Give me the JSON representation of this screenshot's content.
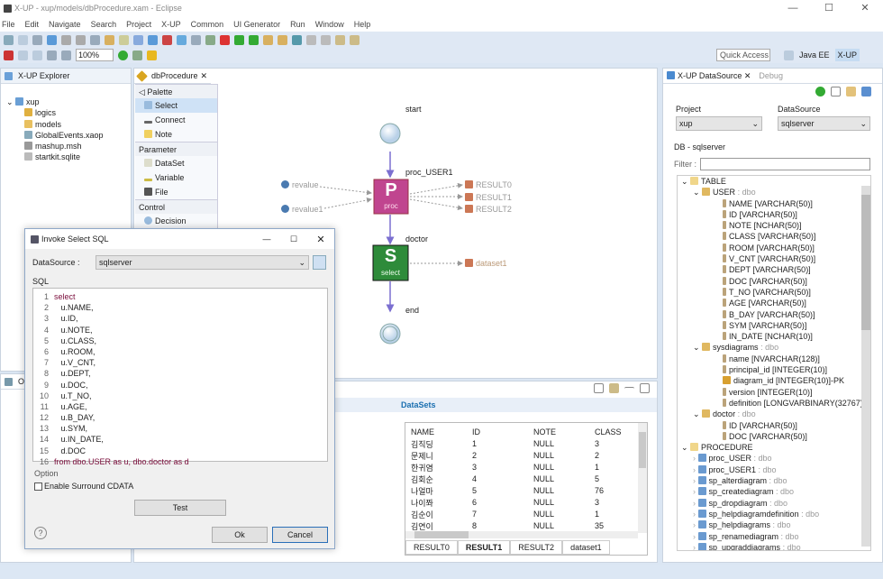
{
  "window": {
    "title": "X-UP - xup/models/dbProcedure.xam - Eclipse",
    "controls": [
      "—",
      "☐",
      "✕"
    ]
  },
  "menu": [
    "File",
    "Edit",
    "Navigate",
    "Search",
    "Project",
    "X-UP",
    "Common",
    "UI Generator",
    "Run",
    "Window",
    "Help"
  ],
  "toolbar": {
    "zoom": "100%",
    "quick_access": "Quick Access",
    "perspectives": [
      "Java EE",
      "X-UP"
    ]
  },
  "explorer": {
    "title": "X-UP Explorer",
    "root": "xup",
    "items": [
      "logics",
      "models",
      "GlobalEvents.xaop",
      "mashup.msh",
      "startkit.sqlite"
    ]
  },
  "outline": {
    "title": "Ou"
  },
  "editor": {
    "tab": "dbProcedure",
    "palette": {
      "title": "Palette",
      "tools": [
        "Select",
        "Connect",
        "Note"
      ],
      "groups": [
        {
          "name": "Parameter",
          "items": [
            "DataSet",
            "Variable",
            "File"
          ]
        },
        {
          "name": "Control",
          "items": [
            "Decision"
          ]
        }
      ]
    },
    "diagram": {
      "start": "start",
      "proc_label": "proc_USER1",
      "proc_icon_letter": "P",
      "proc_sub": "proc",
      "inputs": [
        "revalue",
        "revalue1"
      ],
      "outputs": [
        "RESULT0",
        "RESULT1",
        "RESULT2"
      ],
      "select_label": "doctor",
      "select_icon_letter": "S",
      "select_sub": "select",
      "select_output": "dataset1",
      "end": "end"
    }
  },
  "datasets": {
    "title": "DataSets",
    "columns": [
      "NAME",
      "ID",
      "NOTE",
      "CLASS"
    ],
    "rows": [
      [
        "김직딩",
        "1",
        "NULL",
        "3"
      ],
      [
        "문제니",
        "2",
        "NULL",
        "2"
      ],
      [
        "한귀염",
        "3",
        "NULL",
        "1"
      ],
      [
        "김회순",
        "4",
        "NULL",
        "5"
      ],
      [
        "나얼마",
        "5",
        "NULL",
        "76"
      ],
      [
        "나이쫘",
        "6",
        "NULL",
        "3"
      ],
      [
        "김순이",
        "7",
        "NULL",
        "1"
      ],
      [
        "김연이",
        "8",
        "NULL",
        "35"
      ]
    ],
    "tabs": [
      "RESULT0",
      "RESULT1",
      "RESULT2",
      "dataset1"
    ],
    "active_tab": "RESULT1"
  },
  "datasource": {
    "title": "X-UP DataSource",
    "debug_tab": "Debug",
    "project_label": "Project",
    "project_value": "xup",
    "ds_label": "DataSource",
    "ds_value": "sqlserver",
    "db_label": "DB - sqlserver",
    "filter_label": "Filter :",
    "filter_value": "",
    "tree": [
      {
        "lvl": 0,
        "type": "folder",
        "text": "TABLE"
      },
      {
        "lvl": 1,
        "type": "table",
        "text": "USER",
        "schema": " : dbo"
      },
      {
        "lvl": 2,
        "type": "col",
        "text": "NAME   [VARCHAR(50)]"
      },
      {
        "lvl": 2,
        "type": "col",
        "text": "ID   [VARCHAR(50)]"
      },
      {
        "lvl": 2,
        "type": "col",
        "text": "NOTE   [NCHAR(50)]"
      },
      {
        "lvl": 2,
        "type": "col",
        "text": "CLASS   [VARCHAR(50)]"
      },
      {
        "lvl": 2,
        "type": "col",
        "text": "ROOM   [VARCHAR(50)]"
      },
      {
        "lvl": 2,
        "type": "col",
        "text": "V_CNT   [VARCHAR(50)]"
      },
      {
        "lvl": 2,
        "type": "col",
        "text": "DEPT   [VARCHAR(50)]"
      },
      {
        "lvl": 2,
        "type": "col",
        "text": "DOC   [VARCHAR(50)]"
      },
      {
        "lvl": 2,
        "type": "col",
        "text": "T_NO   [VARCHAR(50)]"
      },
      {
        "lvl": 2,
        "type": "col",
        "text": "AGE   [VARCHAR(50)]"
      },
      {
        "lvl": 2,
        "type": "col",
        "text": "B_DAY   [VARCHAR(50)]"
      },
      {
        "lvl": 2,
        "type": "col",
        "text": "SYM   [VARCHAR(50)]"
      },
      {
        "lvl": 2,
        "type": "col",
        "text": "IN_DATE   [NCHAR(10)]"
      },
      {
        "lvl": 1,
        "type": "table",
        "text": "sysdiagrams",
        "schema": " : dbo"
      },
      {
        "lvl": 2,
        "type": "col",
        "text": "name   [NVARCHAR(128)]"
      },
      {
        "lvl": 2,
        "type": "col",
        "text": "principal_id   [INTEGER(10)]"
      },
      {
        "lvl": 2,
        "type": "pk",
        "text": "diagram_id   [INTEGER(10)]-PK"
      },
      {
        "lvl": 2,
        "type": "col",
        "text": "version   [INTEGER(10)]"
      },
      {
        "lvl": 2,
        "type": "col",
        "text": "definition   [LONGVARBINARY(32767)]"
      },
      {
        "lvl": 1,
        "type": "table",
        "text": "doctor",
        "schema": " : dbo"
      },
      {
        "lvl": 2,
        "type": "col",
        "text": "ID   [VARCHAR(50)]"
      },
      {
        "lvl": 2,
        "type": "col",
        "text": "DOC   [VARCHAR(50)]"
      },
      {
        "lvl": 0,
        "type": "folder",
        "text": "PROCEDURE"
      },
      {
        "lvl": 1,
        "type": "proc",
        "text": "proc_USER",
        "schema": " : dbo"
      },
      {
        "lvl": 1,
        "type": "proc",
        "text": "proc_USER1",
        "schema": " : dbo"
      },
      {
        "lvl": 1,
        "type": "proc",
        "text": "sp_alterdiagram",
        "schema": " : dbo"
      },
      {
        "lvl": 1,
        "type": "proc",
        "text": "sp_creatediagram",
        "schema": " : dbo"
      },
      {
        "lvl": 1,
        "type": "proc",
        "text": "sp_dropdiagram",
        "schema": " : dbo"
      },
      {
        "lvl": 1,
        "type": "proc",
        "text": "sp_helpdiagramdefinition",
        "schema": " : dbo"
      },
      {
        "lvl": 1,
        "type": "proc",
        "text": "sp_helpdiagrams",
        "schema": " : dbo"
      },
      {
        "lvl": 1,
        "type": "proc",
        "text": "sp_renamediagram",
        "schema": " : dbo"
      },
      {
        "lvl": 1,
        "type": "proc",
        "text": "sp_upgraddiagrams",
        "schema": " : dbo"
      }
    ]
  },
  "dialog": {
    "title": "Invoke Select SQL",
    "ds_label": "DataSource :",
    "ds_value": "sqlserver",
    "sql_label": "SQL",
    "sql": [
      "select",
      "   u.NAME,",
      "   u.ID,",
      "   u.NOTE,",
      "   u.CLASS,",
      "   u.ROOM,",
      "   u.V_CNT,",
      "   u.DEPT,",
      "   u.DOC,",
      "   u.T_NO,",
      "   u.AGE,",
      "   u.B_DAY,",
      "   u.SYM,",
      "   u.IN_DATE,",
      "   d.DOC",
      "from dbo.USER as u, dbo.doctor as d"
    ],
    "option_label": "Option",
    "cdata_label": "Enable Surround CDATA",
    "cdata_checked": false,
    "test": "Test",
    "ok": "Ok",
    "cancel": "Cancel"
  },
  "colors": {
    "proc": "#c0458f",
    "select": "#2e8b3a",
    "flow": "#7b6fd0",
    "link": "#1a6fb0"
  }
}
